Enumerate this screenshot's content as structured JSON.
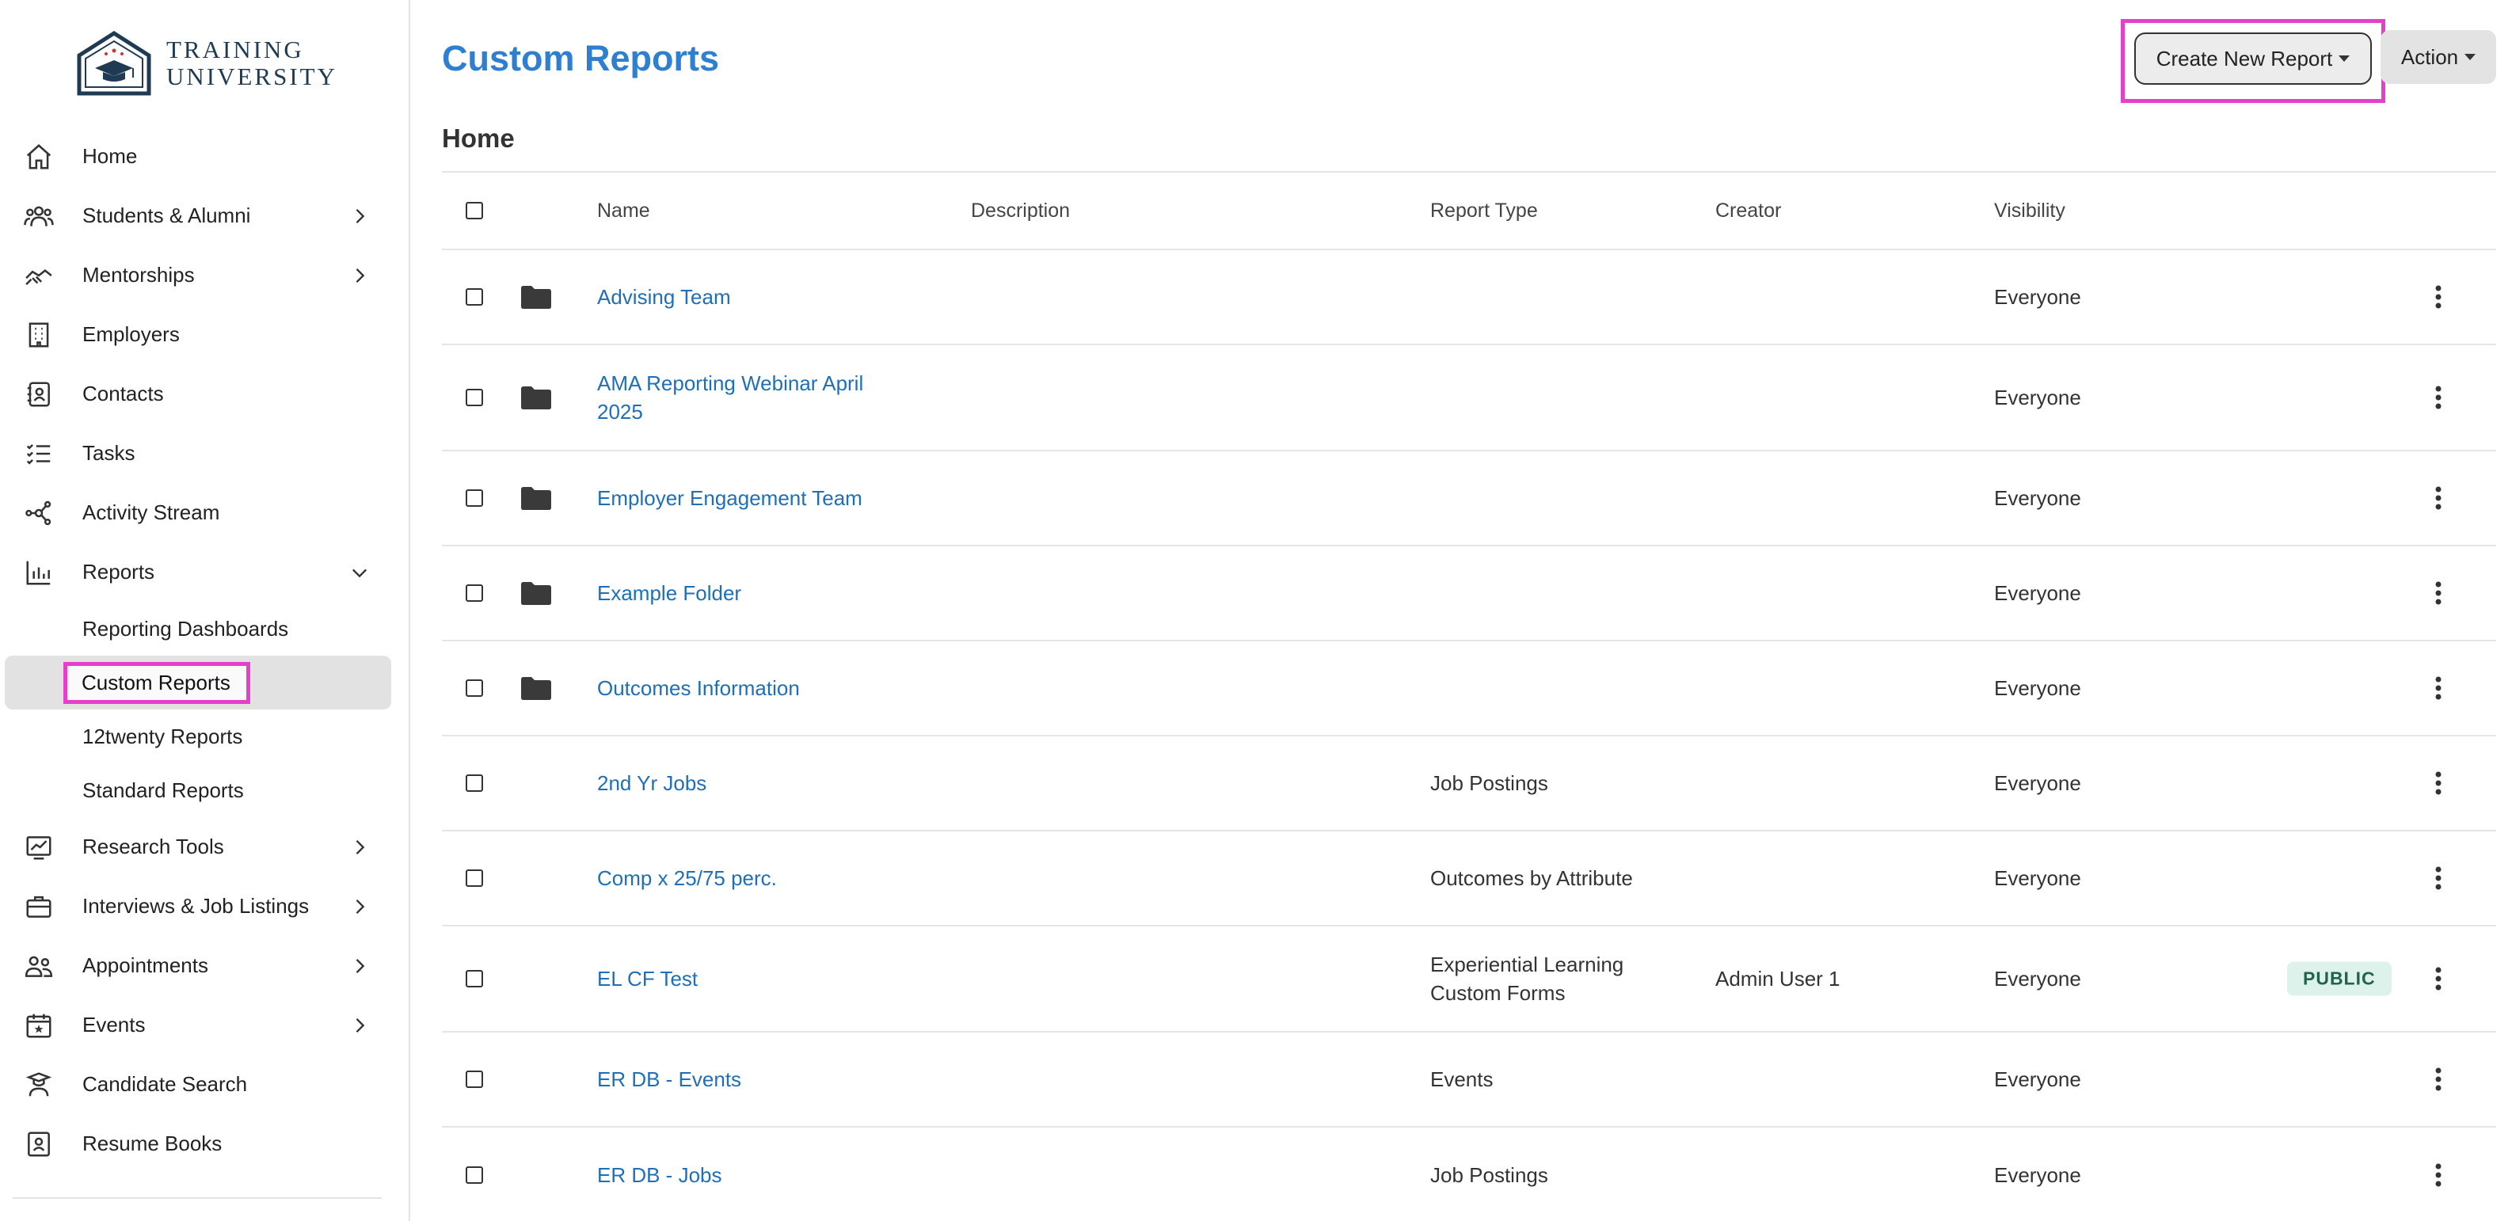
{
  "brand": {
    "line1": "TRAINING",
    "line2": "UNIVERSITY"
  },
  "nav": {
    "home": "Home",
    "students": "Students & Alumni",
    "mentorships": "Mentorships",
    "employers": "Employers",
    "contacts": "Contacts",
    "tasks": "Tasks",
    "activity": "Activity Stream",
    "reports": "Reports",
    "reports_sub": {
      "dashboards": "Reporting Dashboards",
      "custom": "Custom Reports",
      "twelvetwenty": "12twenty Reports",
      "standard": "Standard Reports"
    },
    "research": "Research Tools",
    "interviews": "Interviews & Job Listings",
    "appointments": "Appointments",
    "events": "Events",
    "candidate": "Candidate Search",
    "resume": "Resume Books"
  },
  "header": {
    "title": "Custom Reports",
    "create_button": "Create New Report",
    "action_button": "Action"
  },
  "section": {
    "title": "Home"
  },
  "table": {
    "columns": {
      "name": "Name",
      "description": "Description",
      "report_type": "Report Type",
      "creator": "Creator",
      "visibility": "Visibility"
    },
    "rows": [
      {
        "name": "Advising Team",
        "type": "",
        "creator": "",
        "visibility": "Everyone",
        "folder": true,
        "badge": ""
      },
      {
        "name_line1": "AMA Reporting Webinar April",
        "name_line2": "2025",
        "type": "",
        "creator": "",
        "visibility": "Everyone",
        "folder": true,
        "badge": ""
      },
      {
        "name": "Employer Engagement Team",
        "type": "",
        "creator": "",
        "visibility": "Everyone",
        "folder": true,
        "badge": ""
      },
      {
        "name": "Example Folder",
        "type": "",
        "creator": "",
        "visibility": "Everyone",
        "folder": true,
        "badge": ""
      },
      {
        "name": "Outcomes Information",
        "type": "",
        "creator": "",
        "visibility": "Everyone",
        "folder": true,
        "badge": ""
      },
      {
        "name": "2nd Yr Jobs",
        "type": "Job Postings",
        "creator": "",
        "visibility": "Everyone",
        "folder": false,
        "badge": ""
      },
      {
        "name": "Comp x 25/75 perc.",
        "type": "Outcomes by Attribute",
        "creator": "",
        "visibility": "Everyone",
        "folder": false,
        "badge": ""
      },
      {
        "name": "EL CF Test",
        "type_line1": "Experiential Learning",
        "type_line2": "Custom Forms",
        "creator": "Admin User 1",
        "visibility": "Everyone",
        "folder": false,
        "badge": "PUBLIC"
      },
      {
        "name": "ER DB - Events",
        "type": "Events",
        "creator": "",
        "visibility": "Everyone",
        "folder": false,
        "badge": ""
      },
      {
        "name": "ER DB - Jobs",
        "type": "Job Postings",
        "creator": "",
        "visibility": "Everyone",
        "folder": false,
        "badge": ""
      }
    ]
  },
  "colors": {
    "accent": "#2e7fd0",
    "link": "#1f6fb8",
    "highlight": "#e540c9",
    "badge_bg": "#dcf2ea",
    "badge_text": "#23624d"
  }
}
